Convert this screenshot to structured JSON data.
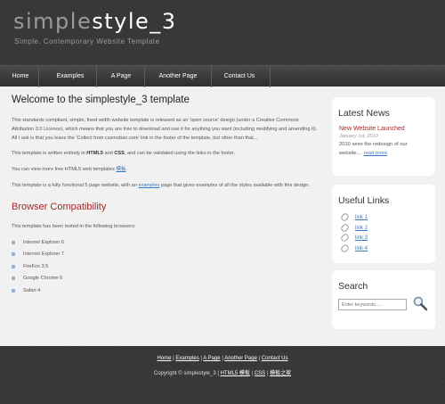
{
  "header": {
    "logo_part1": "simple",
    "logo_part2": "style_3",
    "slogan": "Simple. Contemporary Website Template"
  },
  "nav": {
    "items": [
      {
        "label": "Home"
      },
      {
        "label": "Examples"
      },
      {
        "label": "A Page"
      },
      {
        "label": "Another Page"
      },
      {
        "label": "Contact Us"
      }
    ]
  },
  "content": {
    "title": "Welcome to the simplestyle_3 template",
    "p1": "This standards compliant, simple, fixed width website template is released as an 'open source' design (under a Creative Commons Attribution 3.0 Licence), which means that you are free to download and use it for anything you want (including modifying and amending it). All I ask is that you leave the 'Collect from cssmoban.com' link in the footer of the template, but other than that...",
    "p2_pre": "This template is written entirely in ",
    "p2_b1": "HTML5",
    "p2_mid": " and ",
    "p2_b2": "CSS",
    "p2_post": ", and can be validated using the links in the footer.",
    "p3_pre": "You can view more free HTML5 web templates ",
    "p3_link": "模板",
    "p3_post": ".",
    "p4_pre": "This template is a fully functional 5 page website, with an ",
    "p4_link": "examples",
    "p4_post": " page that gives examples of all the styles available with this design.",
    "section_title": "Browser Compatibility",
    "section_intro": "This template has been tested in the following browsers:",
    "browsers": [
      "Internet Explorer 6",
      "Internet Explorer 7",
      "FireFox 3.5",
      "Google Chrome 6",
      "Safari 4"
    ]
  },
  "sidebar": {
    "news_heading": "Latest News",
    "news_title": "New Website Launched",
    "news_date": "January 1st, 2010",
    "news_body": "2010 sees the redesign of our website.... ",
    "news_more": "read more",
    "links_heading": "Useful Links",
    "links": [
      "link 1",
      "link 2",
      "link 3",
      "link 4"
    ],
    "search_heading": "Search",
    "search_placeholder": "Enter keywords....."
  },
  "footer": {
    "links": [
      "Home",
      "Examples",
      "A Page",
      "Another Page",
      "Contact Us"
    ],
    "copy_pre": "Copyright © simplestyle_3 | ",
    "copy_link1": "HTML5 模板",
    "copy_sep": " | ",
    "copy_link2": "CSS",
    "copy_link3": "模板之家"
  },
  "colors": {
    "accent_red": "#a12a2a",
    "link_blue": "#3a7ac2",
    "header_bg": "#383838"
  }
}
